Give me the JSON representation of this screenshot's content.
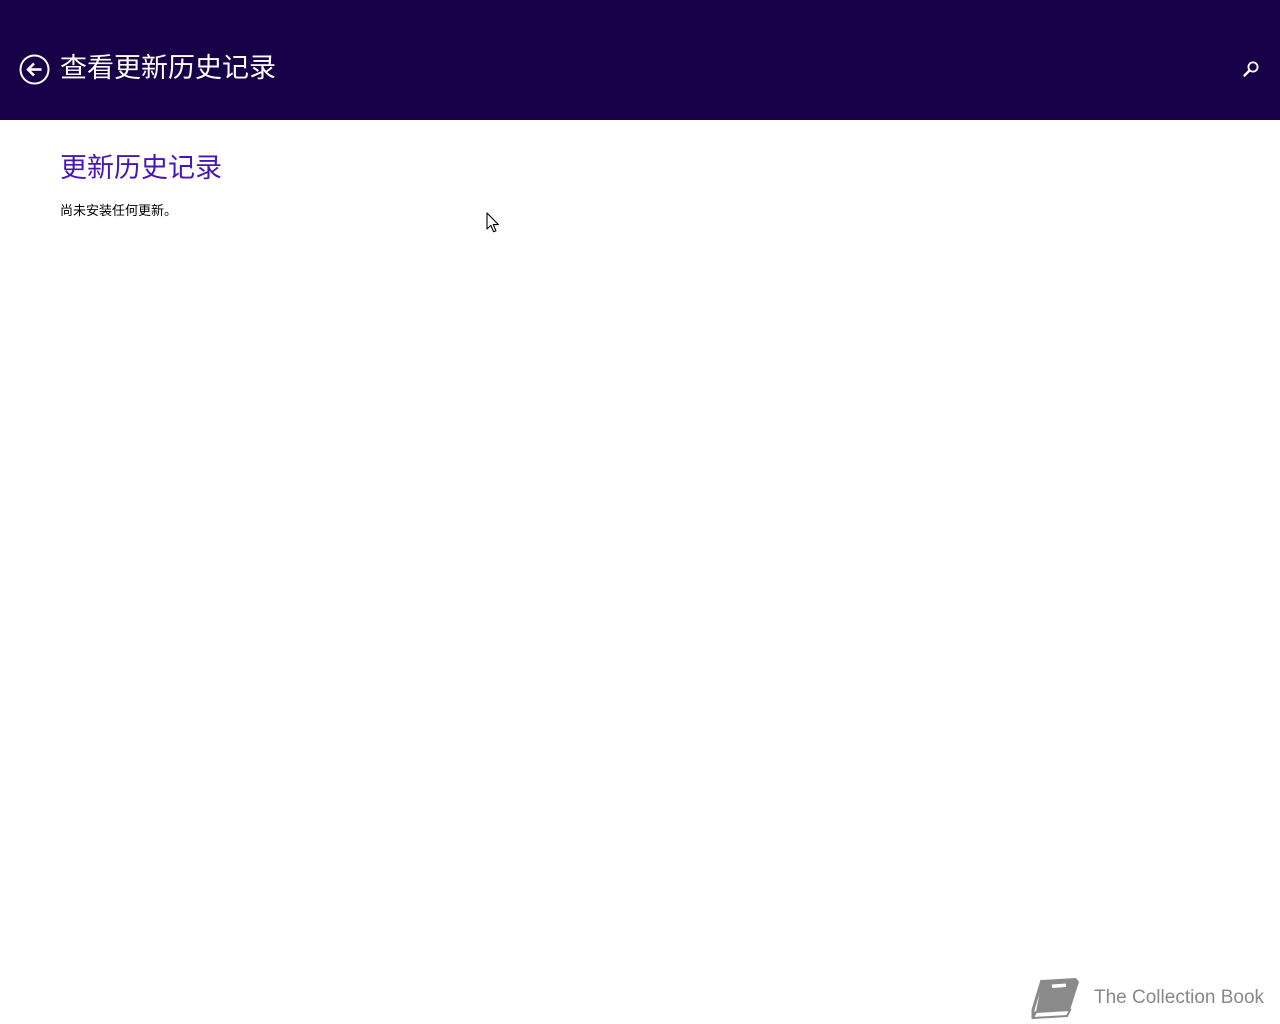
{
  "header": {
    "back_icon": "back-arrow-circle-icon",
    "title": "查看更新历史记录",
    "search_icon": "search-icon",
    "background_color": "#180048"
  },
  "main": {
    "section_title": "更新历史记录",
    "status_text": "尚未安装任何更新。",
    "accent_color": "#4617b4"
  },
  "watermark": {
    "icon": "book-icon",
    "text": "The Collection Book"
  }
}
